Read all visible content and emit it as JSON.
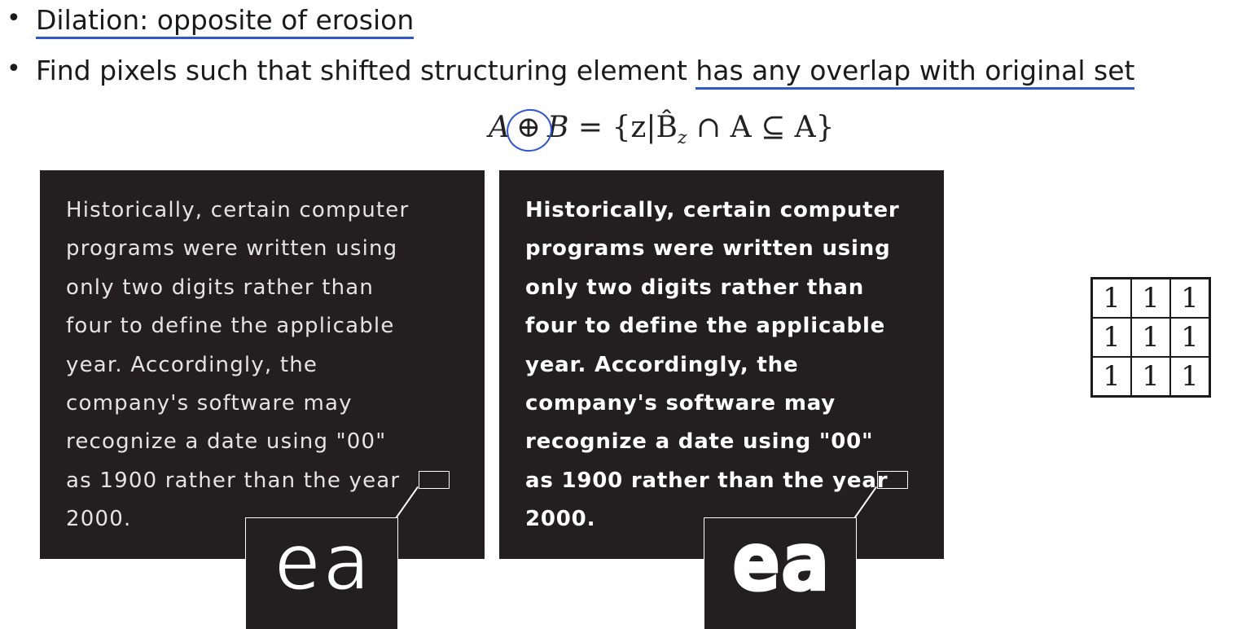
{
  "bullets": [
    {
      "text": "Dilation: opposite of erosion"
    },
    {
      "prefix": "Find pixels such that shifted structuring element ",
      "underlined": "has any overlap with original set"
    }
  ],
  "formula": {
    "lhs_a": "A",
    "op": "⊕",
    "lhs_b": "B",
    "rhs": "= {z|B̂",
    "sub": "z",
    "rest": " ∩ A  ⊆ A}"
  },
  "panels": {
    "lines": [
      "Historically, certain computer",
      "programs were written using",
      "only two digits rather than",
      "four to define the applicable",
      "year. Accordingly, the",
      "company's software may",
      "recognize a date using \"00\"",
      "as 1900 rather than the year",
      "2000."
    ],
    "zoom_letters": "ea"
  },
  "kernel": {
    "rows": [
      [
        "1",
        "1",
        "1"
      ],
      [
        "1",
        "1",
        "1"
      ],
      [
        "1",
        "1",
        "1"
      ]
    ]
  },
  "colors": {
    "annotation_blue": "#2a55e5",
    "panel_bg": "#231f20",
    "panel_text": "#e4e4e4"
  }
}
